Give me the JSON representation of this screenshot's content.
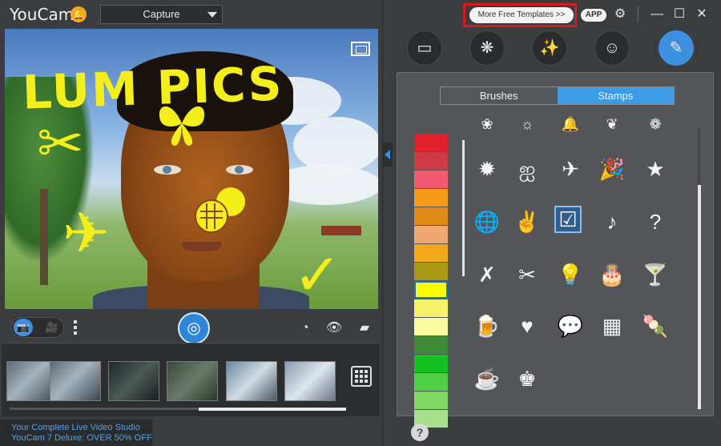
{
  "app": {
    "title": "YouCam"
  },
  "header": {
    "mode": "Capture"
  },
  "preview": {
    "scribble_text": "LUM PICS"
  },
  "promo": {
    "line1": "Your Complete Live Video Studio",
    "line2": "YouCam 7 Deluxe: OVER 50% OFF"
  },
  "right": {
    "templates_label": "More Free Templates  >>",
    "app_label": "APP",
    "tabs": [
      "Brushes",
      "Stamps"
    ],
    "active_tab": "Stamps",
    "help": "?"
  },
  "palette": [
    "#e0202b",
    "#cf3a46",
    "#f35a70",
    "#f59a1a",
    "#e08a18",
    "#f0a870",
    "#f5a71a",
    "#a89a14",
    "#ffff00",
    "#f7f26a",
    "#fafaa0",
    "#3f8a36",
    "#14c21f",
    "#4ed142",
    "#7fd862",
    "#a6e08c"
  ],
  "selected_swatch_index": 8,
  "colors": {
    "accent": "#3d8fe0",
    "stamp_yellow": "#f4ef1a",
    "highlight_red": "#d61a22"
  }
}
